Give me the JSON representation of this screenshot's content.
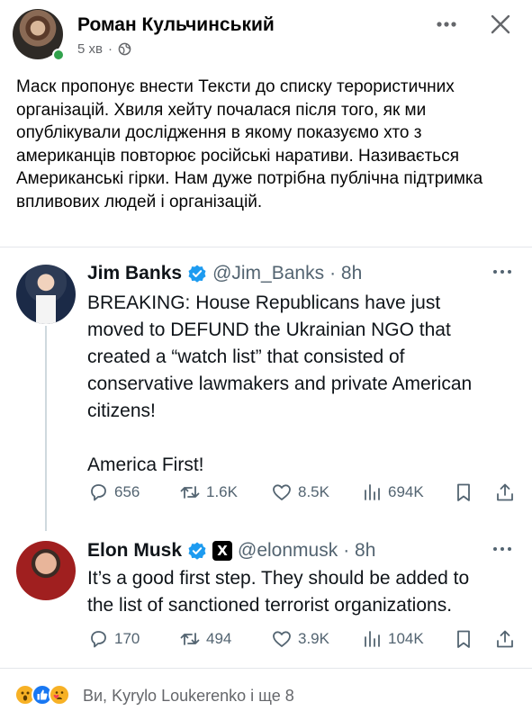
{
  "post": {
    "author": "Роман Кульчинський",
    "time": "5 хв",
    "separator": "·",
    "icons": {
      "privacy": "globe-icon",
      "menu": "more-horizontal-icon",
      "close": "close-icon"
    },
    "text": "Маск пропонує внести Тексти до списку терористичних організацій.  Хвиля хейту почалася після того, як ми опублікували дослідження в якому показуємо хто з американців повторює російські наративи. Називається Американські гірки. Нам дуже потрібна публічна підтримка впливових людей і організацій."
  },
  "tweets": [
    {
      "name": "Jim Banks",
      "handle": "@Jim_Banks",
      "time": "· 8h",
      "body_lines": [
        "BREAKING: House Republicans have just",
        "moved to DEFUND the Ukrainian NGO that",
        "created a “watch list” that consisted of",
        "conservative lawmakers and private American",
        "citizens!"
      ],
      "body_extra": "America First!",
      "replies": "656",
      "retweets": "1.6K",
      "likes": "8.5K",
      "views": "694K"
    },
    {
      "name": "Elon Musk",
      "handle": "@elonmusk",
      "time": "· 8h",
      "badge": "X",
      "body_lines": [
        "It’s a good first step. They should be added to",
        "the list of sanctioned terrorist organizations."
      ],
      "replies": "170",
      "retweets": "494",
      "likes": "3.9K",
      "views": "104K"
    }
  ],
  "reactions": {
    "icons": [
      "wow-reaction-icon",
      "like-reaction-icon",
      "care-reaction-icon"
    ],
    "summary": "Ви, Kyrylo Loukerenko і ще 8"
  },
  "colors": {
    "twitter_blue": "#1d9bf0",
    "fb_green": "#31a24c",
    "muted": "#536471"
  }
}
